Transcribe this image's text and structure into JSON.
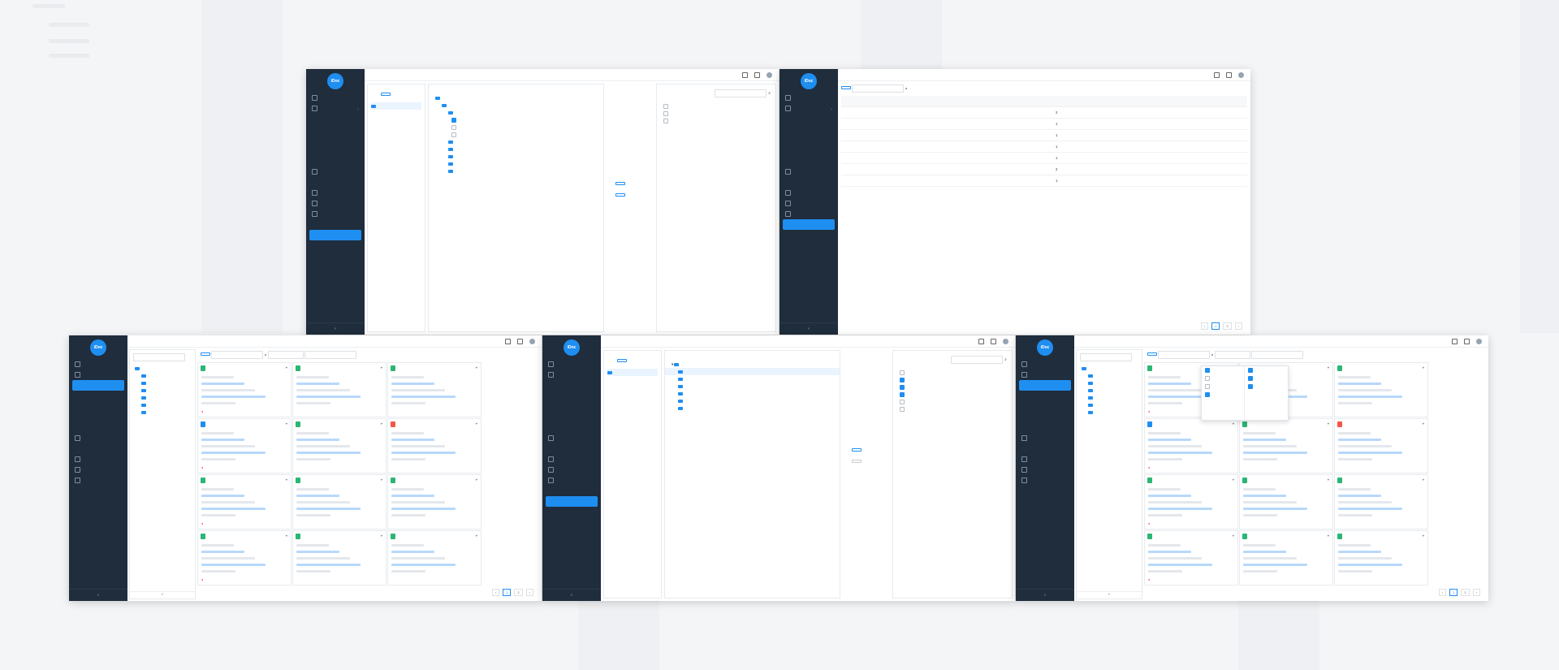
{
  "colors": {
    "accent": "#1f8ef1",
    "sidebar": "#1f2d3d",
    "danger": "#f5564a",
    "success": "#2bb673"
  },
  "app": {
    "logo": "iDoc",
    "brand": "",
    "breadcrumb": "",
    "user": ""
  },
  "sidebar_menu": [
    {
      "label": "",
      "icon": "home-icon"
    },
    {
      "label": "",
      "icon": "grid-icon"
    },
    {
      "label": "",
      "icon": "list-icon"
    },
    {
      "label": "",
      "icon": "calendar-icon"
    },
    {
      "label": "",
      "icon": "user-icon"
    },
    {
      "label": "",
      "icon": "gear-icon"
    }
  ],
  "collapse_glyph": "‹",
  "tree_window": {
    "left_list": [
      "",
      ""
    ],
    "tree_items": [
      "",
      "",
      "",
      "",
      "",
      "",
      "",
      "",
      "",
      "",
      ""
    ],
    "right_list": [
      "",
      "",
      ""
    ],
    "transfer_buttons": [
      "",
      ""
    ]
  },
  "table_window": {
    "headers": [
      "",
      "",
      "",
      ""
    ],
    "rows": [
      [
        "",
        "",
        "2",
        ""
      ],
      [
        "",
        "",
        "1",
        ""
      ],
      [
        "",
        "",
        "1",
        ""
      ],
      [
        "",
        "",
        "1",
        ""
      ],
      [
        "",
        "",
        "1",
        ""
      ],
      [
        "",
        "",
        "2",
        ""
      ],
      [
        "",
        "",
        "1",
        ""
      ]
    ],
    "pager": {
      "pages": [
        "1",
        "2"
      ],
      "current": "1"
    }
  },
  "card_window_a": {
    "cards": [
      {
        "badge": "",
        "badge_color": "#2bb673",
        "title": ""
      },
      {
        "badge": "",
        "badge_color": "#2bb673",
        "title": ""
      },
      {
        "badge": "",
        "badge_color": "#2bb673",
        "title": ""
      },
      {
        "badge": "",
        "badge_color": "#1f8ef1",
        "title": ""
      },
      {
        "badge": "",
        "badge_color": "#2bb673",
        "title": ""
      },
      {
        "badge": "",
        "badge_color": "#f5564a",
        "title": ""
      },
      {
        "badge": "",
        "badge_color": "#2bb673",
        "title": ""
      },
      {
        "badge": "",
        "badge_color": "#2bb673",
        "title": ""
      },
      {
        "badge": "",
        "badge_color": "#2bb673",
        "title": ""
      }
    ]
  },
  "card_window_b": {
    "dropdown_items": [
      "",
      "",
      "",
      ""
    ]
  }
}
